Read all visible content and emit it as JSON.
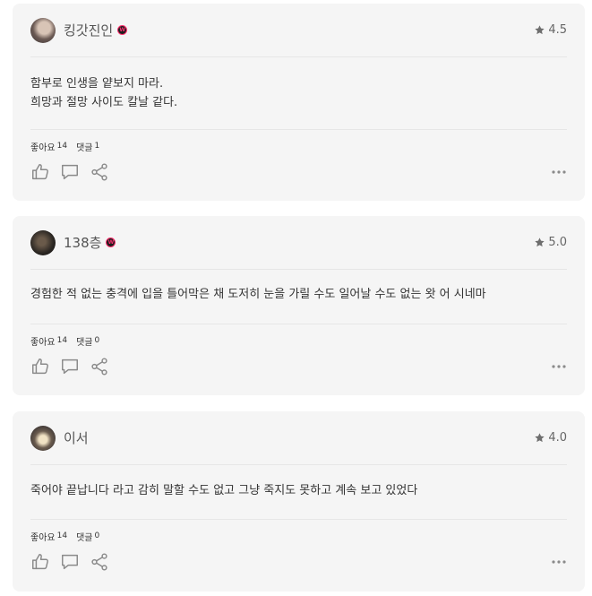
{
  "reviews": [
    {
      "username": "킹갓진인",
      "badge": "W",
      "rating": "4.5",
      "text_lines": [
        "함부로 인생을 얕보지 마라.",
        "희망과 절망 사이도 칼날 같다."
      ],
      "likes_label": "좋아요",
      "likes": "14",
      "comments_label": "댓글",
      "comments": "1"
    },
    {
      "username": "138층",
      "badge": "W",
      "rating": "5.0",
      "text_lines": [
        "경험한 적 없는 충격에 입을 틀어막은 채 도저히 눈을 가릴 수도 일어날 수도 없는 왓 어 시네마"
      ],
      "likes_label": "좋아요",
      "likes": "14",
      "comments_label": "댓글",
      "comments": "0"
    },
    {
      "username": "이서",
      "rating": "4.0",
      "text_lines": [
        "죽어야 끝납니다 라고 감히 말할 수도 없고 그냥 죽지도 못하고 계속 보고 있었다"
      ],
      "likes_label": "좋아요",
      "likes": "14",
      "comments_label": "댓글",
      "comments": "0"
    }
  ],
  "icons": {
    "star": "star-icon",
    "like": "thumbs-up-icon",
    "comment": "comment-icon",
    "share": "share-icon",
    "more": "more-horizontal-icon"
  },
  "colors": {
    "card_background": "#f5f5f5",
    "badge_accent": "#ff2f6e",
    "icon_gray": "#8a8a8a"
  }
}
